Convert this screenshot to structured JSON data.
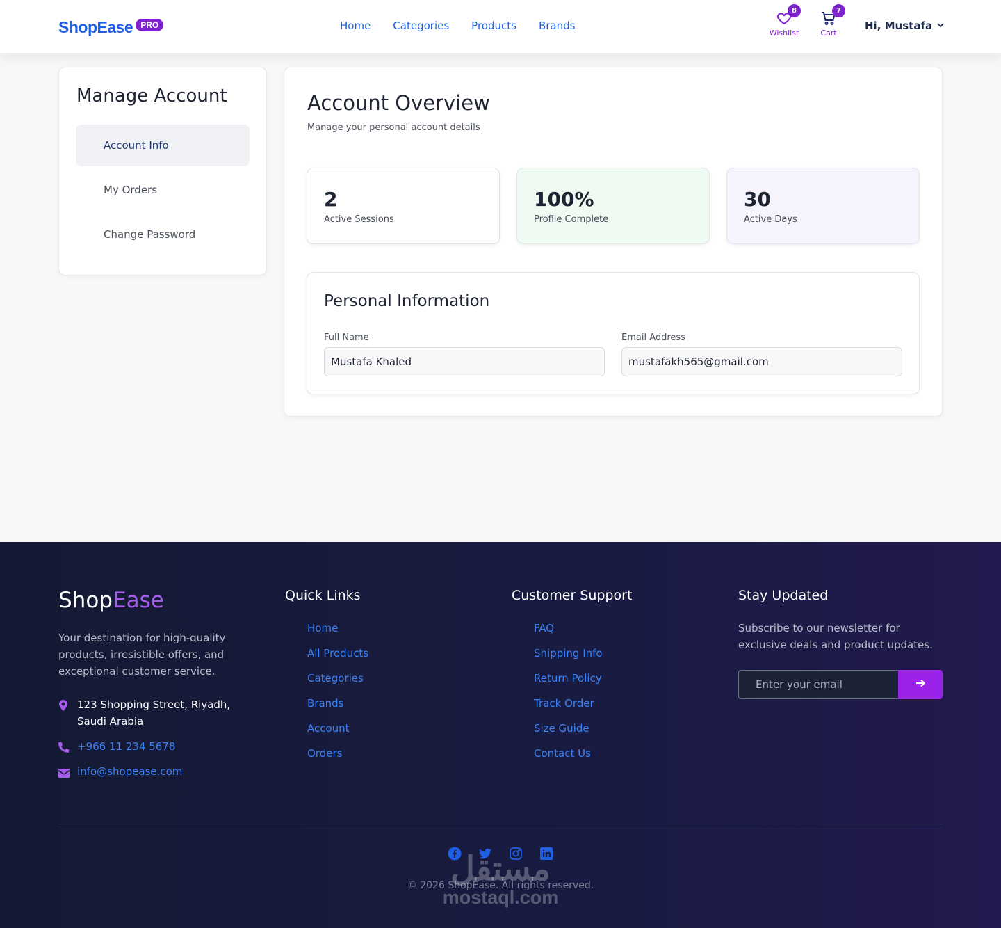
{
  "header": {
    "logo_text": "ShopEase",
    "logo_badge": "PRO",
    "nav": [
      "Home",
      "Categories",
      "Products",
      "Brands"
    ],
    "wishlist": {
      "label": "Wishlist",
      "count": "8",
      "icon": "heart-icon"
    },
    "cart": {
      "label": "Cart",
      "count": "7",
      "icon": "cart-icon"
    },
    "user_greeting": "Hi, Mustafa"
  },
  "sidebar": {
    "title": "Manage Account",
    "items": [
      {
        "label": "Account Info",
        "active": true
      },
      {
        "label": "My Orders",
        "active": false
      },
      {
        "label": "Change Password",
        "active": false
      }
    ]
  },
  "main": {
    "title": "Account Overview",
    "subtitle": "Manage your personal account details",
    "stats": [
      {
        "value": "2",
        "label": "Active Sessions"
      },
      {
        "value": "100%",
        "label": "Profile Complete"
      },
      {
        "value": "30",
        "label": "Active Days"
      }
    ],
    "personal": {
      "title": "Personal Information",
      "full_name_label": "Full Name",
      "full_name_value": "Mustafa Khaled",
      "email_label": "Email Address",
      "email_value": "mustafakh565@gmail.com"
    }
  },
  "footer": {
    "logo_part1": "Shop",
    "logo_part2": "Ease",
    "description": "Your destination for high-quality products, irresistible offers, and exceptional customer service.",
    "address": "123 Shopping Street, Riyadh, Saudi Arabia",
    "phone": "+966 11 234 5678",
    "email": "info@shopease.com",
    "quick_links_title": "Quick Links",
    "quick_links": [
      "Home",
      "All Products",
      "Categories",
      "Brands",
      "Account",
      "Orders"
    ],
    "support_title": "Customer Support",
    "support_links": [
      "FAQ",
      "Shipping Info",
      "Return Policy",
      "Track Order",
      "Size Guide",
      "Contact Us"
    ],
    "newsletter_title": "Stay Updated",
    "newsletter_text": "Subscribe to our newsletter for exclusive deals and product updates.",
    "newsletter_placeholder": "Enter your email",
    "socials": [
      "facebook-icon",
      "twitter-icon",
      "instagram-icon",
      "linkedin-icon"
    ],
    "copyright": "© 2026 ShopEase. All rights reserved.",
    "watermark_ar": "مستقل",
    "watermark_en": "mostaql.com"
  },
  "colors": {
    "brand_blue": "#1f5fe6",
    "brand_purple": "#7e22ce",
    "link_blue": "#3b82f6",
    "footer_bg": "#161b3a"
  }
}
